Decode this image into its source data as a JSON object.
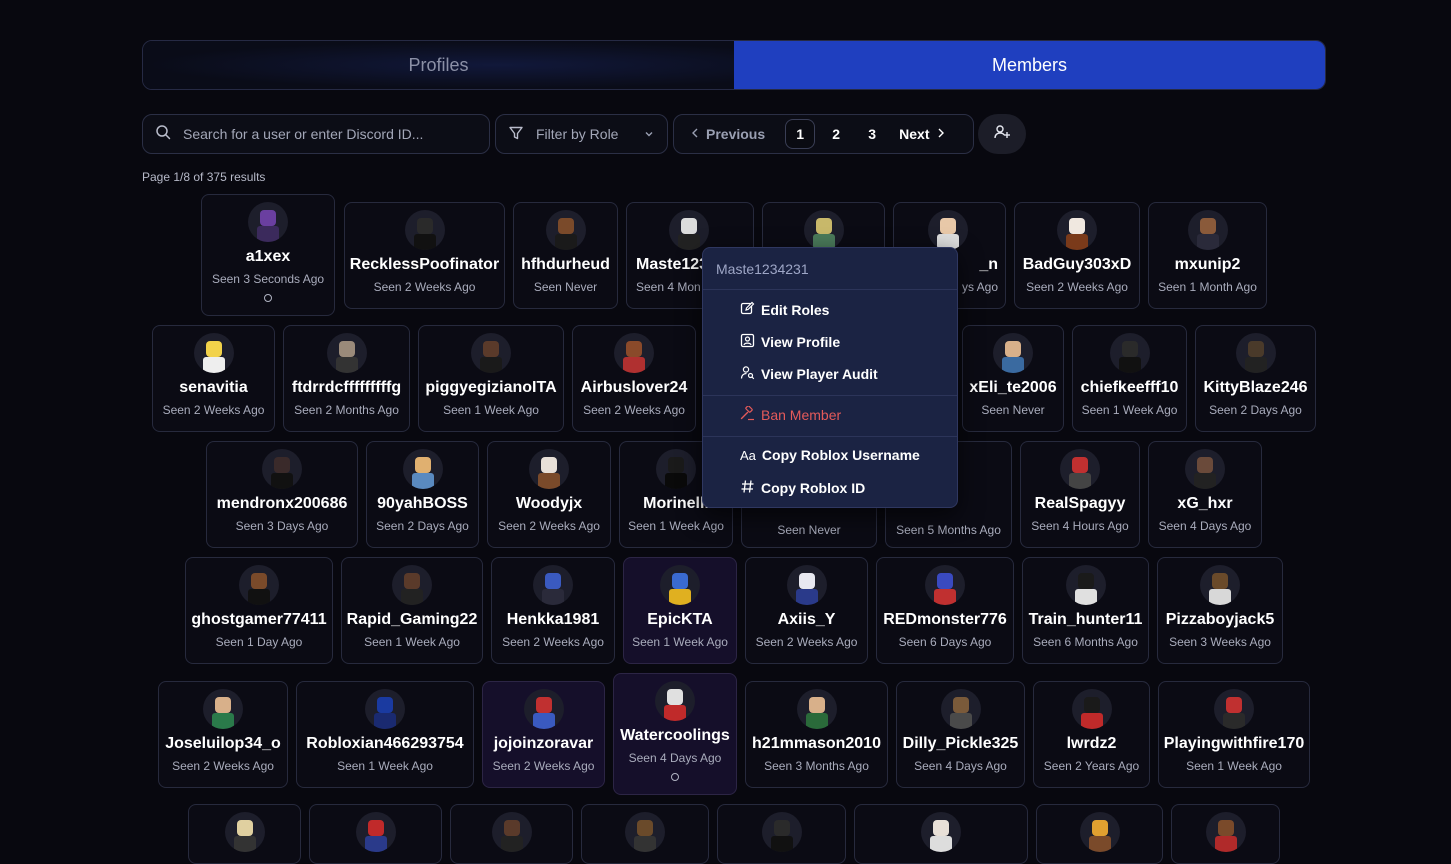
{
  "tabs": [
    {
      "label": "Profiles",
      "active": false
    },
    {
      "label": "Members",
      "active": true
    }
  ],
  "toolbar": {
    "search_placeholder": "Search for a user or enter Discord ID...",
    "filter_label": "Filter by Role",
    "previous_label": "Previous",
    "pages": [
      "1",
      "2",
      "3"
    ],
    "current_page": "1",
    "next_label": "Next"
  },
  "page_info": "Page 1/8 of 375 results",
  "members": [
    {
      "name": "a1xex",
      "seen": "Seen 3 Seconds Ago"
    },
    {
      "name": "RecklessPoofinator",
      "seen": "Seen 2 Weeks Ago"
    },
    {
      "name": "hfhdurheud",
      "seen": "Seen Never"
    },
    {
      "name": "Maste123",
      "seen": "Seen 4 Mon"
    },
    {
      "name": "",
      "seen": ""
    },
    {
      "name": "_n",
      "seen": "ys Ago"
    },
    {
      "name": "BadGuy303xD",
      "seen": "Seen 2 Weeks Ago"
    },
    {
      "name": "mxunip2",
      "seen": "Seen 1 Month Ago"
    },
    {
      "name": "senavitia",
      "seen": "Seen 2 Weeks Ago"
    },
    {
      "name": "ftdrrdcfffffffffg",
      "seen": "Seen 2 Months Ago"
    },
    {
      "name": "piggyegizianoITA",
      "seen": "Seen 1 Week Ago"
    },
    {
      "name": "Airbuslover24",
      "seen": "Seen 2 Weeks Ago"
    },
    {
      "name": "xEli_te2006",
      "seen": "Seen Never"
    },
    {
      "name": "chiefkeefff10",
      "seen": "Seen 1 Week Ago"
    },
    {
      "name": "KittyBlaze246",
      "seen": "Seen 2 Days Ago"
    },
    {
      "name": "mendronx200686",
      "seen": "Seen 3 Days Ago"
    },
    {
      "name": "90yahBOSS",
      "seen": "Seen 2 Days Ago"
    },
    {
      "name": "Woodyjx",
      "seen": "Seen 2 Weeks Ago"
    },
    {
      "name": "Morinelli",
      "seen": "Seen 1 Week Ago"
    },
    {
      "name": "",
      "seen": "Seen Never"
    },
    {
      "name": "",
      "seen": "Seen 5 Months Ago"
    },
    {
      "name": "RealSpagyy",
      "seen": "Seen 4 Hours Ago"
    },
    {
      "name": "xG_hxr",
      "seen": "Seen 4 Days Ago"
    },
    {
      "name": "ghostgamer77411",
      "seen": "Seen 1 Day Ago"
    },
    {
      "name": "Rapid_Gaming22",
      "seen": "Seen 1 Week Ago"
    },
    {
      "name": "Henkka1981",
      "seen": "Seen 2 Weeks Ago"
    },
    {
      "name": "EpicKTA",
      "seen": "Seen 1 Week Ago"
    },
    {
      "name": "Axiis_Y",
      "seen": "Seen 2 Weeks Ago"
    },
    {
      "name": "REDmonster776",
      "seen": "Seen 6 Days Ago"
    },
    {
      "name": "Train_hunter11",
      "seen": "Seen 6 Months Ago"
    },
    {
      "name": "Pizzaboyjack5",
      "seen": "Seen 3 Weeks Ago"
    },
    {
      "name": "Joseluilop34_o",
      "seen": "Seen 2 Weeks Ago"
    },
    {
      "name": "Robloxian466293754",
      "seen": "Seen 1 Week Ago"
    },
    {
      "name": "jojoinzoravar",
      "seen": "Seen 2 Weeks Ago"
    },
    {
      "name": "Watercoolings",
      "seen": "Seen 4 Days Ago"
    },
    {
      "name": "h21mmason2010",
      "seen": "Seen 3 Months Ago"
    },
    {
      "name": "Dilly_Pickle325",
      "seen": "Seen 4 Days Ago"
    },
    {
      "name": "lwrdz2",
      "seen": "Seen 2 Years Ago"
    },
    {
      "name": "Playingwithfire170",
      "seen": "Seen 1 Week Ago"
    }
  ],
  "context_menu": {
    "title": "Maste1234231",
    "items": {
      "edit_roles": "Edit Roles",
      "view_profile": "View Profile",
      "view_audit": "View Player Audit",
      "ban": "Ban Member",
      "copy_username": "Copy Roblox Username",
      "copy_username_icon_text": "Aa",
      "copy_id": "Copy Roblox ID"
    }
  },
  "colors": {
    "background": "#08080f",
    "active_tab": "#1f3fbf",
    "danger": "#e45a5a",
    "menu_bg": "#1b2343"
  },
  "icons": [
    "search-icon",
    "filter-icon",
    "chevron-down-icon",
    "chevron-left-icon",
    "chevron-right-icon",
    "user-plus-icon",
    "edit-icon",
    "id-card-icon",
    "user-search-icon",
    "gavel-icon",
    "hash-icon"
  ]
}
